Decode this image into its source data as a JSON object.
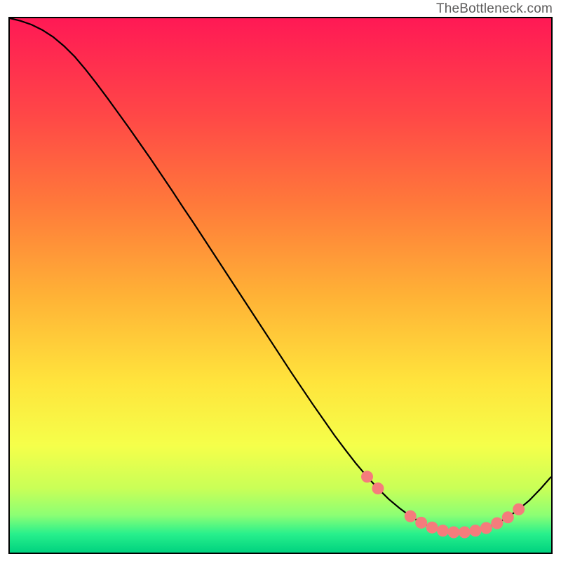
{
  "attribution": "TheBottleneck.com",
  "chart_data": {
    "type": "line",
    "title": "",
    "xlabel": "",
    "ylabel": "",
    "xlim": [
      0,
      100
    ],
    "ylim": [
      0,
      100
    ],
    "x": [
      0,
      2,
      4,
      6,
      8,
      10,
      12,
      14,
      16,
      18,
      20,
      22,
      24,
      26,
      28,
      30,
      32,
      34,
      36,
      38,
      40,
      42,
      44,
      46,
      48,
      50,
      52,
      54,
      56,
      58,
      60,
      62,
      64,
      66,
      68,
      70,
      72,
      74,
      76,
      78,
      80,
      82,
      84,
      86,
      88,
      90,
      92,
      94,
      96,
      98,
      100
    ],
    "y": [
      100,
      99.5,
      98.8,
      97.8,
      96.5,
      94.8,
      92.8,
      90.4,
      87.8,
      85.1,
      82.3,
      79.5,
      76.6,
      73.7,
      70.7,
      67.7,
      64.6,
      61.6,
      58.5,
      55.4,
      52.3,
      49.2,
      46.1,
      43.0,
      39.9,
      36.8,
      33.7,
      30.7,
      27.7,
      24.8,
      21.9,
      19.2,
      16.6,
      14.2,
      12.0,
      10.0,
      8.3,
      6.8,
      5.6,
      4.7,
      4.1,
      3.8,
      3.8,
      4.1,
      4.6,
      5.5,
      6.6,
      8.1,
      9.8,
      11.9,
      14.2
    ],
    "marker_indices": [
      33,
      34,
      37,
      38,
      39,
      40,
      41,
      42,
      43,
      44,
      45,
      46,
      47
    ],
    "marker_color": "#f57c7c",
    "line_color": "#000000",
    "gradient_stops": [
      {
        "offset": 0.0,
        "color": "#ff1955"
      },
      {
        "offset": 0.18,
        "color": "#ff4747"
      },
      {
        "offset": 0.35,
        "color": "#ff7a3a"
      },
      {
        "offset": 0.52,
        "color": "#ffb236"
      },
      {
        "offset": 0.68,
        "color": "#ffe43c"
      },
      {
        "offset": 0.8,
        "color": "#f5ff4a"
      },
      {
        "offset": 0.88,
        "color": "#c9ff57"
      },
      {
        "offset": 0.93,
        "color": "#8cff74"
      },
      {
        "offset": 0.965,
        "color": "#28f08c"
      },
      {
        "offset": 1.0,
        "color": "#00d27f"
      }
    ]
  }
}
